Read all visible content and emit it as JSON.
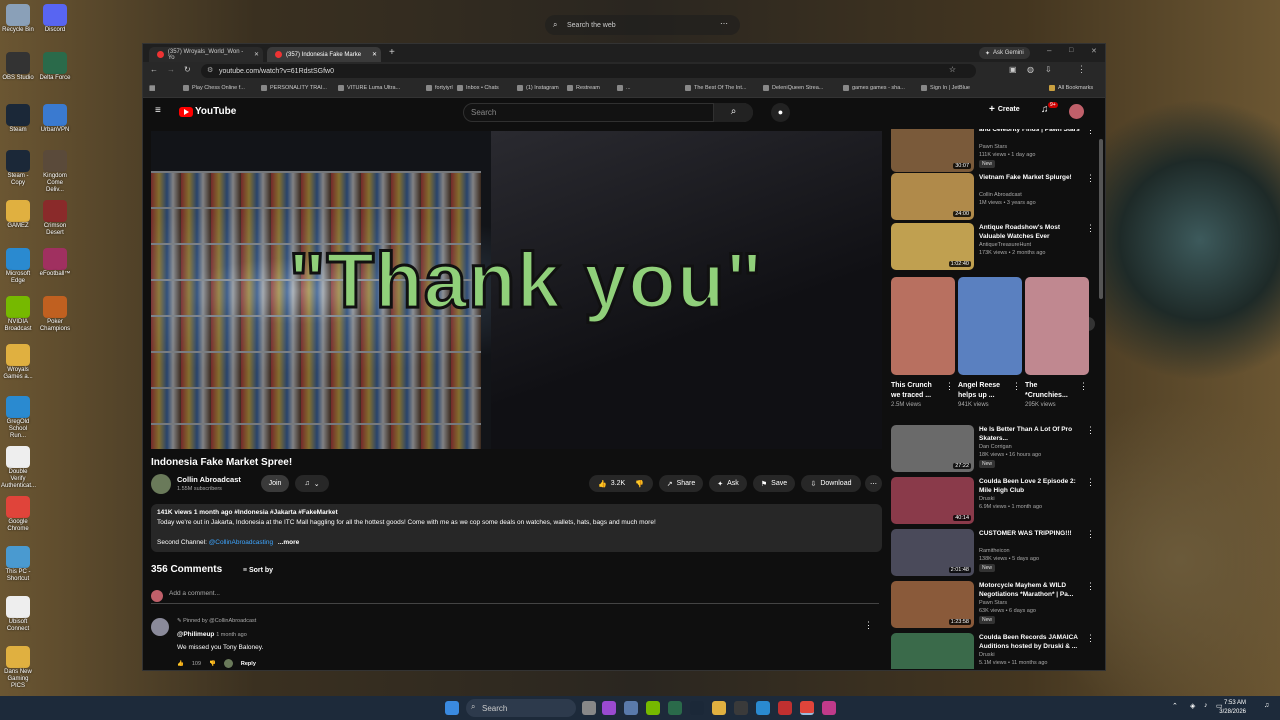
{
  "desktop": {
    "icons": [
      {
        "label": "Recycle Bin",
        "color": "#8aa0b8"
      },
      {
        "label": "Discord",
        "color": "#5865f2"
      },
      {
        "label": "OBS Studio",
        "color": "#333333"
      },
      {
        "label": "Delta Force",
        "color": "#2a6a4a"
      },
      {
        "label": "Steam",
        "color": "#1b2838"
      },
      {
        "label": "UrbanVPN",
        "color": "#3a7ad0"
      },
      {
        "label": "Steam - Copy",
        "color": "#1b2838"
      },
      {
        "label": "Kingdom Come Deliv...",
        "color": "#5a4a3a"
      },
      {
        "label": "GAMEZ",
        "color": "#e0b040"
      },
      {
        "label": "Crimson Desert",
        "color": "#8a2a2a"
      },
      {
        "label": "Microsoft Edge",
        "color": "#2a8ad0"
      },
      {
        "label": "eFootball™",
        "color": "#a03060"
      },
      {
        "label": "NVIDIA Broadcast",
        "color": "#76b900"
      },
      {
        "label": "Poker Champions",
        "color": "#c06020"
      },
      {
        "label": "Wroyals Games a...",
        "color": "#e0b040"
      },
      {
        "label": "GregOld School Run...",
        "color": "#2a8ad0"
      },
      {
        "label": "Double Verify Authenticat...",
        "color": "#eeeeee"
      },
      {
        "label": "Google Chrome",
        "color": "#e0443a"
      },
      {
        "label": "This PC - Shortcut",
        "color": "#4a9ad0"
      },
      {
        "label": "Ubisoft Connect",
        "color": "#eeeeee"
      },
      {
        "label": "Dans New Gaming PICS",
        "color": "#e0b040"
      }
    ]
  },
  "os_search": {
    "placeholder": "Search the web"
  },
  "taskbar": {
    "search_label": "Search",
    "time": "7:53 AM",
    "date": "3/28/2026"
  },
  "browser": {
    "tabs": [
      {
        "label": "(357) Wroyals_World_Won - Yo"
      },
      {
        "label": "(357) Indonesia Fake Marke"
      }
    ],
    "ask_gemini": "Ask Gemini",
    "url": "youtube.com/watch?v=61RdstSGfw0",
    "bookmarks": [
      "Play Chess Online f...",
      "PERSONALITY TRAI...",
      "VITURE Luma Ultra...",
      "fortyiyrl",
      "Inbox • Chats",
      "(1) Instagram",
      "Restream",
      "...",
      "The Best Of The Int...",
      "DeleniQueen Strea...",
      "games games - sha...",
      "Sign In | JetBlue"
    ],
    "all_bookmarks": "All Bookmarks"
  },
  "youtube": {
    "logo_text": "YouTube",
    "search_placeholder": "Search",
    "create_label": "Create",
    "notif_count": "9+",
    "video": {
      "caption": "\"Thank you\"",
      "title": "Indonesia Fake Market Spree!",
      "channel": "Collin Abroadcast",
      "subscribers": "1.55M subscribers",
      "join": "Join",
      "likes": "3.2K",
      "share": "Share",
      "ask": "Ask",
      "save": "Save",
      "download": "Download",
      "desc_meta": "141K views  1 month ago  #Indonesia #Jakarta #FakeMarket",
      "desc_text": "Today we're out in Jakarta, Indonesia at the ITC Mall haggling for all the hottest goods! Come with me as we cop some deals on watches, wallets, hats, bags and much more!",
      "second_channel_label": "Second Channel:",
      "second_channel_link": "@CollinAbroadcasting",
      "more": "...more"
    },
    "comments": {
      "count": "356 Comments",
      "sort": "Sort by",
      "add": "Add a comment...",
      "pinned": "Pinned by @CollinAbroadcast",
      "author": "@Philimeup",
      "ago": "1 month ago",
      "text": "We missed you  Tony Baloney.",
      "likes": "109",
      "reply": "Reply"
    },
    "sidebar": [
      {
        "title": "and Celebrity Finds | Pawn Stars",
        "channel": "Pawn Stars",
        "meta": "111K views • 1 day ago",
        "new": "New",
        "duration": "30:07",
        "color": "#7a5a3a"
      },
      {
        "title": "Vietnam Fake Market Splurge!",
        "channel": "Collin Abroadcast",
        "meta": "1M views • 3 years ago",
        "new": "",
        "duration": "24:00",
        "color": "#b08a4a"
      },
      {
        "title": "Antique Roadshow's Most Valuable Watches Ever",
        "channel": "AntiqueTreasureHunt",
        "meta": "173K views • 2 months ago",
        "new": "",
        "duration": "1:02:40",
        "color": "#c0a050"
      },
      {
        "title": "He Is Better Than A Lot Of Pro Skaters...",
        "channel": "Dan Corrigan",
        "meta": "18K views • 16 hours ago",
        "new": "New",
        "duration": "27:22",
        "color": "#6a6a6a"
      },
      {
        "title": "Coulda Been Love 2 Episode 2: Mile High Club",
        "channel": "Druski",
        "meta": "6.9M views • 1 month ago",
        "new": "",
        "duration": "40:14",
        "color": "#8a3a4a"
      },
      {
        "title": "CUSTOMER WAS TRIPPING!!!",
        "channel": "Ramitheicon",
        "meta": "138K views • 5 days ago",
        "new": "New",
        "duration": "2:01:48",
        "color": "#4a4a5a"
      },
      {
        "title": "Motorcycle Mayhem & WILD Negotiations *Marathon* | Pa...",
        "channel": "Pawn Stars",
        "meta": "63K views • 6 days ago",
        "new": "New",
        "duration": "1:23:58",
        "color": "#8a5a3a"
      },
      {
        "title": "Coulda Been Records JAMAICA Auditions hosted by Druski & ...",
        "channel": "Druski",
        "meta": "5.1M views • 11 months ago",
        "new": "",
        "duration": "",
        "color": "#3a6a4a"
      }
    ],
    "shorts": [
      {
        "title": "This Crunch we traced ...",
        "views": "2.5M views",
        "color": "#b87060"
      },
      {
        "title": "Angel Reese helps up ...",
        "views": "941K views",
        "color": "#5a80c0"
      },
      {
        "title": "The *Crunchies...",
        "views": "295K views",
        "color": "#c08890"
      }
    ]
  }
}
